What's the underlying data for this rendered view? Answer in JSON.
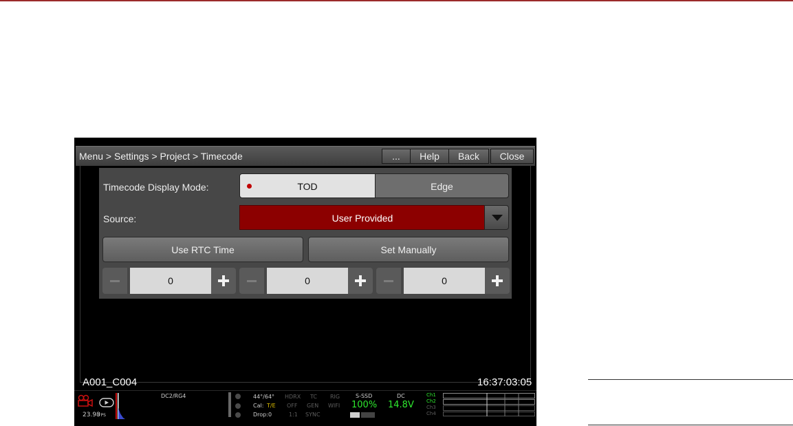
{
  "titlebar": {
    "breadcrumb": "Menu > Settings > Project > Timecode",
    "more_label": "...",
    "help_label": "Help",
    "back_label": "Back",
    "close_label": "Close"
  },
  "timecode_display_mode": {
    "label": "Timecode Display Mode:",
    "options": [
      "TOD",
      "Edge"
    ],
    "selected": "TOD"
  },
  "source": {
    "label": "Source:",
    "value": "User Provided"
  },
  "buttons": {
    "use_rtc": "Use RTC Time",
    "set_manually": "Set Manually"
  },
  "steppers": [
    {
      "value": "0"
    },
    {
      "value": "0"
    },
    {
      "value": "0"
    }
  ],
  "overlay": {
    "clip_name": "A001_C004",
    "timecode": "16:37:03:05"
  },
  "status": {
    "fps": "23.98",
    "fps_unit": "FPS",
    "sensor": "DC2/RG4",
    "temp": "44°/64°",
    "cal_label": "Cal:",
    "cal_value": "T/E",
    "drop": "Drop:0",
    "hdrx": "HDRX",
    "hdrx_val": "OFF",
    "ratio": "1:1",
    "tc": "TC",
    "gen": "GEN",
    "sync": "SYNC",
    "rig": "RIG",
    "wifi": "WIFI",
    "media_label": "S-SSD",
    "media_value": "100%",
    "power_label": "DC",
    "power_value": "14.8V",
    "channels": [
      "Ch1",
      "Ch2",
      "Ch3",
      "Ch4"
    ],
    "colors": {
      "accent": "#8c0000",
      "ok": "#2ee82e",
      "brand_red": "#cc1010"
    }
  }
}
